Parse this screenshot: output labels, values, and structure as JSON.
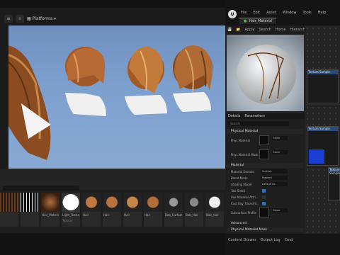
{
  "viewport": {
    "toolbar": {
      "platforms_label": "Platforms"
    }
  },
  "content_browser": {
    "tiles": [
      {
        "label": "",
        "sub": ""
      },
      {
        "label": "",
        "sub": ""
      },
      {
        "label": "Hair_Material",
        "sub": ""
      },
      {
        "label": "Light_Texture",
        "sub": "Texture"
      },
      {
        "label": "Hair",
        "sub": ""
      },
      {
        "label": "Hair",
        "sub": ""
      },
      {
        "label": "Hair",
        "sub": ""
      },
      {
        "label": "Hair",
        "sub": ""
      },
      {
        "label": "Bob_Curtain",
        "sub": ""
      },
      {
        "label": "Bob_Hair",
        "sub": ""
      },
      {
        "label": "Bob_Hair",
        "sub": ""
      }
    ]
  },
  "material_editor": {
    "logo": "U",
    "menu": [
      "File",
      "Edit",
      "Asset",
      "Window",
      "Tools",
      "Help"
    ],
    "asset_tab": "Hair_Material",
    "toolbar": {
      "save": "Save",
      "browse": "Browse",
      "apply": "Apply",
      "search": "Search",
      "home": "Home",
      "hierarchy": "Hierarchy"
    },
    "details": {
      "tabs": [
        "Details",
        "Parameters"
      ],
      "search_placeholder": "Search",
      "sections": {
        "physical_material": "Physical Material",
        "material": "Material",
        "advanced": "Advanced",
        "physical_material_mask": "Physical Material Mask"
      },
      "rows": {
        "phys_material": "Phys Material",
        "phys_material_mask": "Phys Material Mask",
        "material_domain": "Material Domain",
        "blend_mode": "Blend Mode",
        "shading_model": "Shading Model",
        "two_sided": "Two Sided",
        "use_material_attr": "Use Material Attri...",
        "cast_ray_traced": "Cast Ray Traced S...",
        "subsurface_profile": "Subsurface Profile"
      },
      "values": {
        "none1": "None",
        "none2": "None",
        "none3": "None",
        "none_btn": "None",
        "domain": "Surface",
        "blend": "Masked",
        "shading": "Default Lit"
      }
    },
    "status": {
      "content_drawer": "Content Drawer",
      "output_log": "Output Log",
      "cmd": "Cmd"
    },
    "nodes": [
      {
        "title": "Texture Sample"
      },
      {
        "title": "Texture Sample"
      },
      {
        "title": "Texture Sample"
      }
    ]
  }
}
